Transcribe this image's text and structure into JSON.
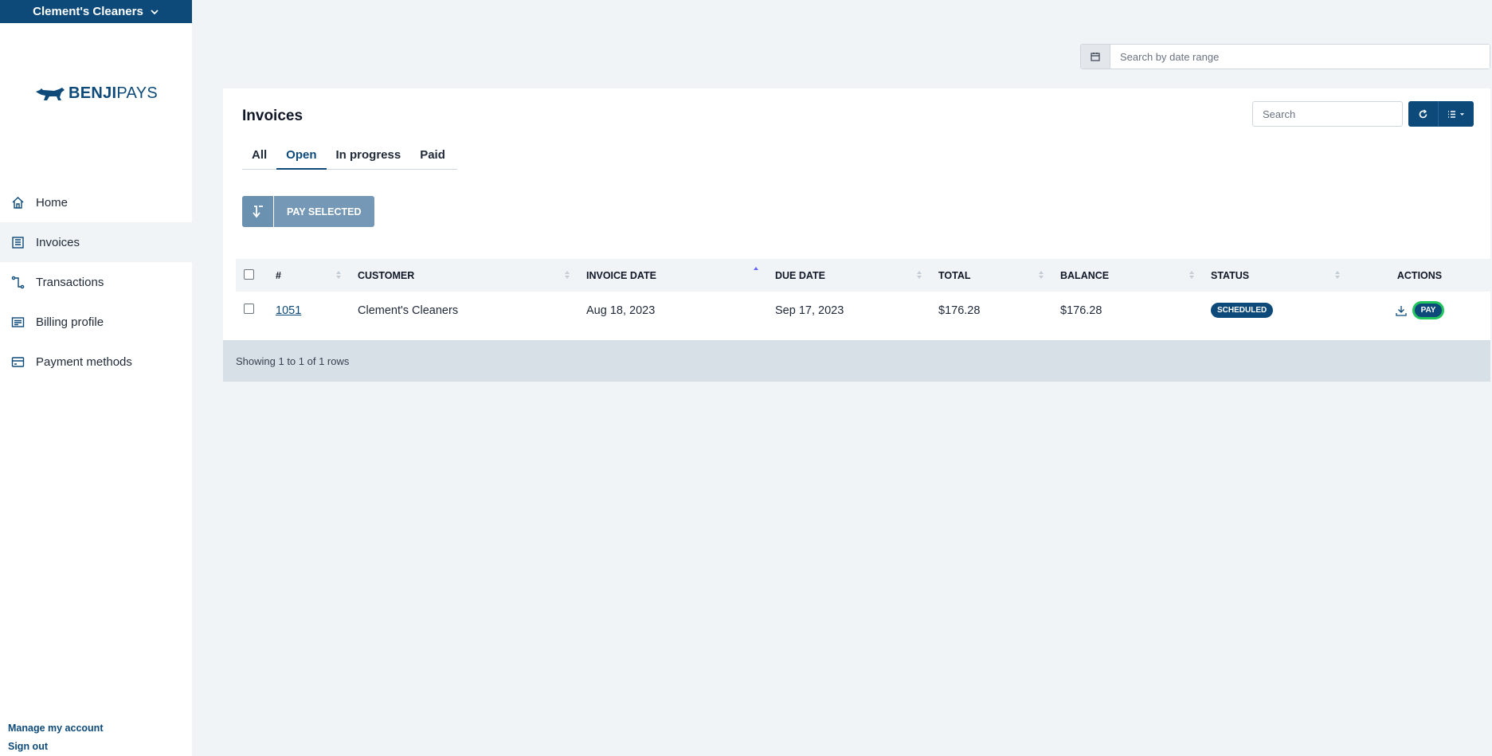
{
  "sidebar": {
    "org_name": "Clement's Cleaners",
    "logo": {
      "bold": "BENJI",
      "light": "PAYS"
    },
    "items": [
      {
        "label": "Home",
        "icon": "home-icon"
      },
      {
        "label": "Invoices",
        "icon": "invoice-icon"
      },
      {
        "label": "Transactions",
        "icon": "transactions-icon"
      },
      {
        "label": "Billing profile",
        "icon": "billing-icon"
      },
      {
        "label": "Payment methods",
        "icon": "credit-card-icon"
      }
    ],
    "active_item": "Invoices",
    "footer": {
      "manage": "Manage my account",
      "signout": "Sign out"
    }
  },
  "date_search": {
    "placeholder": "Search by date range"
  },
  "main": {
    "title": "Invoices",
    "tabs": [
      "All",
      "Open",
      "In progress",
      "Paid"
    ],
    "active_tab": "Open",
    "pay_selected_label": "PAY SELECTED",
    "search_placeholder": "Search",
    "table": {
      "columns": [
        "#",
        "CUSTOMER",
        "INVOICE DATE",
        "DUE DATE",
        "TOTAL",
        "BALANCE",
        "STATUS",
        "ACTIONS"
      ],
      "sorted_column": "INVOICE DATE",
      "rows": [
        {
          "number": "1051",
          "customer": "Clement's Cleaners",
          "invoice_date": "Aug 18, 2023",
          "due_date": "Sep 17, 2023",
          "total": "$176.28",
          "balance": "$176.28",
          "status": "SCHEDULED",
          "action_label": "PAY"
        }
      ]
    },
    "footer_text": "Showing 1 to 1 of 1 rows"
  },
  "colors": {
    "brand": "#0d4a7a",
    "pay_ring": "#22c55e",
    "background": "#f1f4f7"
  }
}
